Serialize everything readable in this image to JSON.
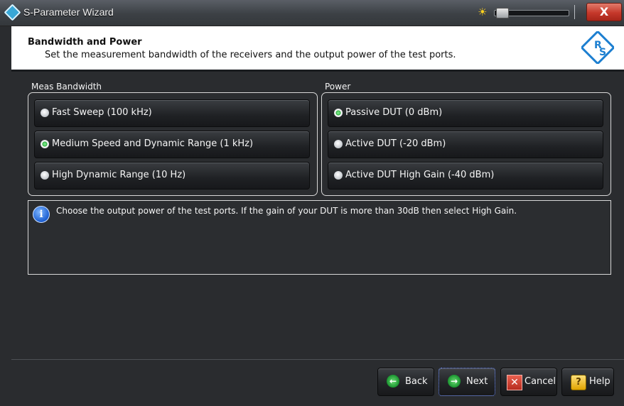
{
  "window": {
    "title": "S-Parameter Wizard",
    "close_glyph": "X"
  },
  "header": {
    "title": "Bandwidth and Power",
    "description": "Set the measurement bandwidth of the receivers and the output power of the test ports.",
    "logo_text_top": "R",
    "logo_text_bottom": "S"
  },
  "bandwidth": {
    "label": "Meas Bandwidth",
    "options": [
      {
        "label": "Fast Sweep (100 kHz)",
        "selected": false
      },
      {
        "label": "Medium Speed and Dynamic Range (1 kHz)",
        "selected": true
      },
      {
        "label": "High Dynamic Range (10 Hz)",
        "selected": false
      }
    ]
  },
  "power": {
    "label": "Power",
    "options": [
      {
        "label": "Passive DUT (0 dBm)",
        "selected": true
      },
      {
        "label": "Active DUT (-20 dBm)",
        "selected": false
      },
      {
        "label": "Active DUT High Gain (-40 dBm)",
        "selected": false
      }
    ]
  },
  "info": {
    "text": "Choose the output power of the test ports. If the gain of your DUT is more than 30dB then select High Gain."
  },
  "footer": {
    "back": "Back",
    "next": "Next",
    "cancel": "Cancel",
    "help": "Help"
  }
}
